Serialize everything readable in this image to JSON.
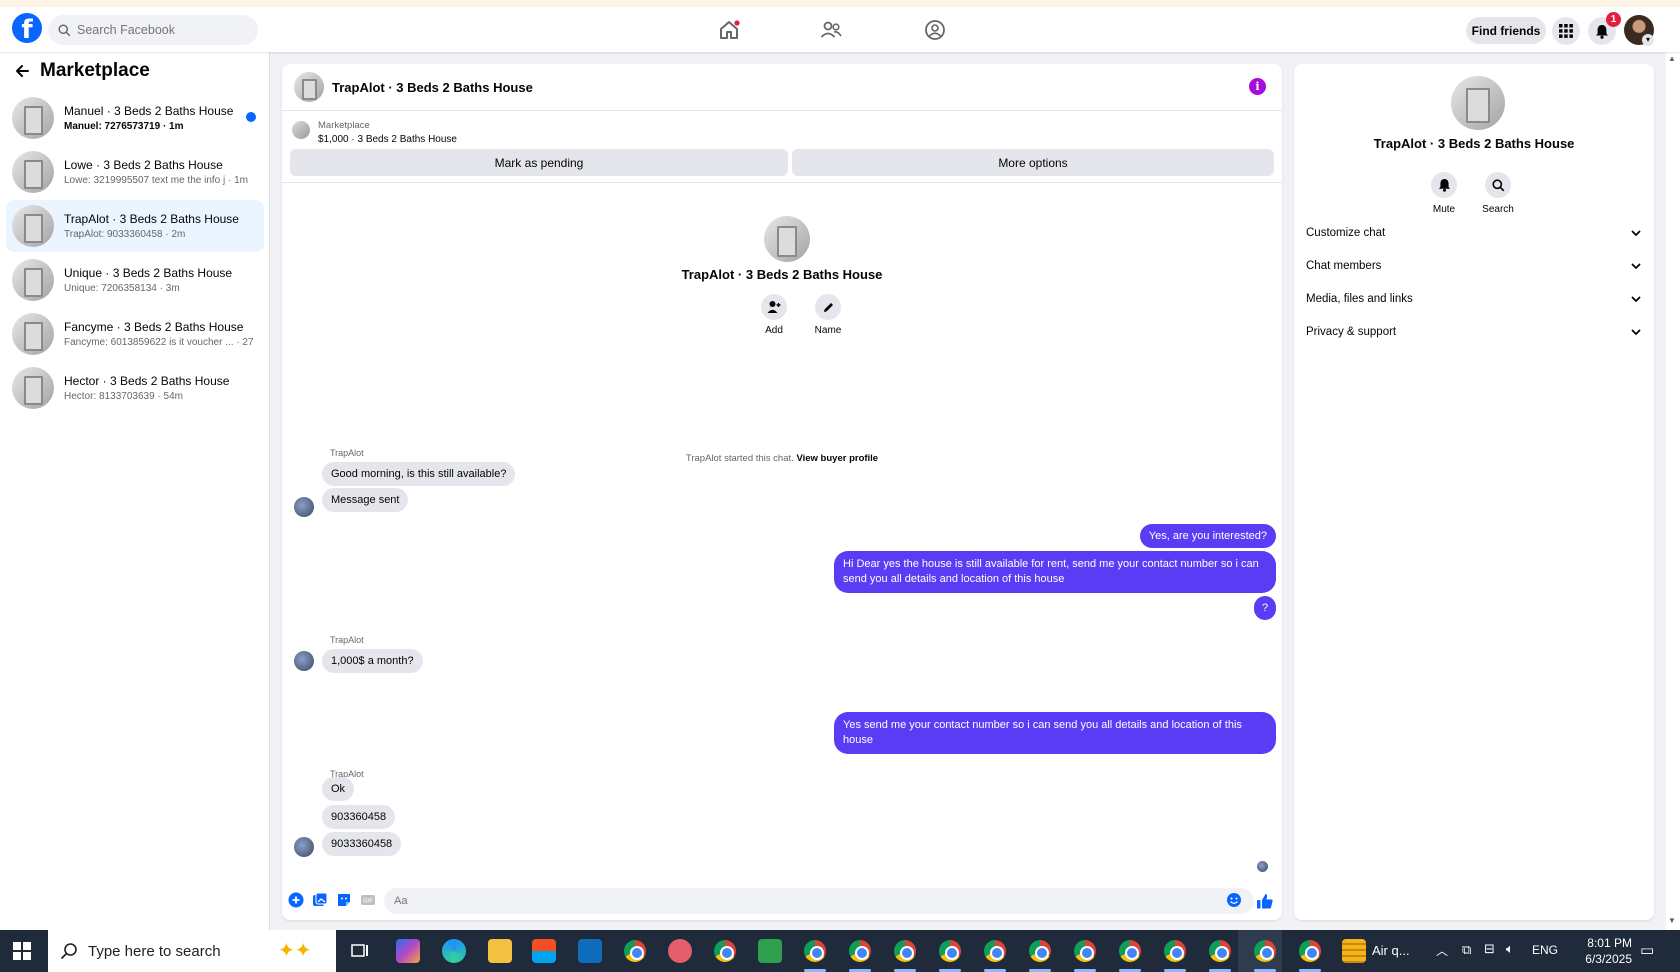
{
  "topbar": {
    "logo": "f",
    "search_placeholder": "Search Facebook",
    "find_friends": "Find friends",
    "notification_count": "1",
    "icons": [
      "home-icon",
      "friends-icon",
      "groups-icon",
      "menu-grid-icon",
      "bell-icon"
    ]
  },
  "left_panel": {
    "title": "Marketplace",
    "conversations": [
      {
        "title": "Manuel · 3 Beds 2 Baths House",
        "preview": "Manuel: 7276573719",
        "time": " · 1m",
        "unread": true,
        "active": false
      },
      {
        "title": "Lowe · 3 Beds 2 Baths House",
        "preview": "Lowe: 3219995507 text me the info j",
        "time": " · 1m",
        "unread": false,
        "active": false
      },
      {
        "title": "TrapAlot · 3 Beds 2 Baths House",
        "preview": "TrapAlot: 9033360458",
        "time": " · 2m",
        "unread": false,
        "active": true
      },
      {
        "title": "Unique · 3 Beds 2 Baths House",
        "preview": "Unique: 7206358134",
        "time": " · 3m",
        "unread": false,
        "active": false
      },
      {
        "title": "Fancyme · 3 Beds 2 Baths House",
        "preview": "Fancyme: 6013859622 is it voucher ...",
        "time": " · 27m",
        "unread": false,
        "active": false
      },
      {
        "title": "Hector · 3 Beds 2 Baths House",
        "preview": "Hector: 8133703639",
        "time": " · 54m",
        "unread": false,
        "active": false
      }
    ]
  },
  "chat": {
    "header_title": "TrapAlot · 3 Beds 2 Baths House",
    "info_glyph": "i",
    "marketplace_label": "Marketplace",
    "listing": "$1,000 · 3 Beds 2 Baths House",
    "mark_pending": "Mark as pending",
    "more_options": "More options",
    "intro_name": "TrapAlot · 3 Beds 2 Baths House",
    "add_label": "Add",
    "name_label": "Name",
    "started_text": "TrapAlot started this chat.",
    "view_profile": "View buyer profile",
    "messages": {
      "sender1": "TrapAlot",
      "m1": "Good morning, is this still available?",
      "m2": "Message sent",
      "m3": "Yes, are you interested?",
      "m4": "Hi Dear yes the house is still available for rent, send me your contact number so i can send you all details and location of this house",
      "m5": "?",
      "sender2": "TrapAlot",
      "m6": "1,000$ a month?",
      "m7": "Yes  send me your contact number so i can send you all details and location of this house",
      "sender3": "TrapAlot",
      "m8": "Ok",
      "m9": "903360458",
      "m10": "9033360458"
    },
    "composer_placeholder": "Aa"
  },
  "info_panel": {
    "name": "TrapAlot · 3 Beds 2 Baths House",
    "mute": "Mute",
    "search": "Search",
    "sections": [
      "Customize chat",
      "Chat members",
      "Media, files and links",
      "Privacy & support"
    ]
  },
  "taskbar": {
    "search_text": "Type here to search",
    "weather": "Air q...",
    "lang": "ENG",
    "time": "8:01 PM",
    "date": "6/3/2025"
  },
  "colors": {
    "brand": "#0866ff",
    "outgoing_bubble": "#5b3cf5",
    "info_icon": "#a40ddb",
    "badge": "#e41e3f"
  }
}
